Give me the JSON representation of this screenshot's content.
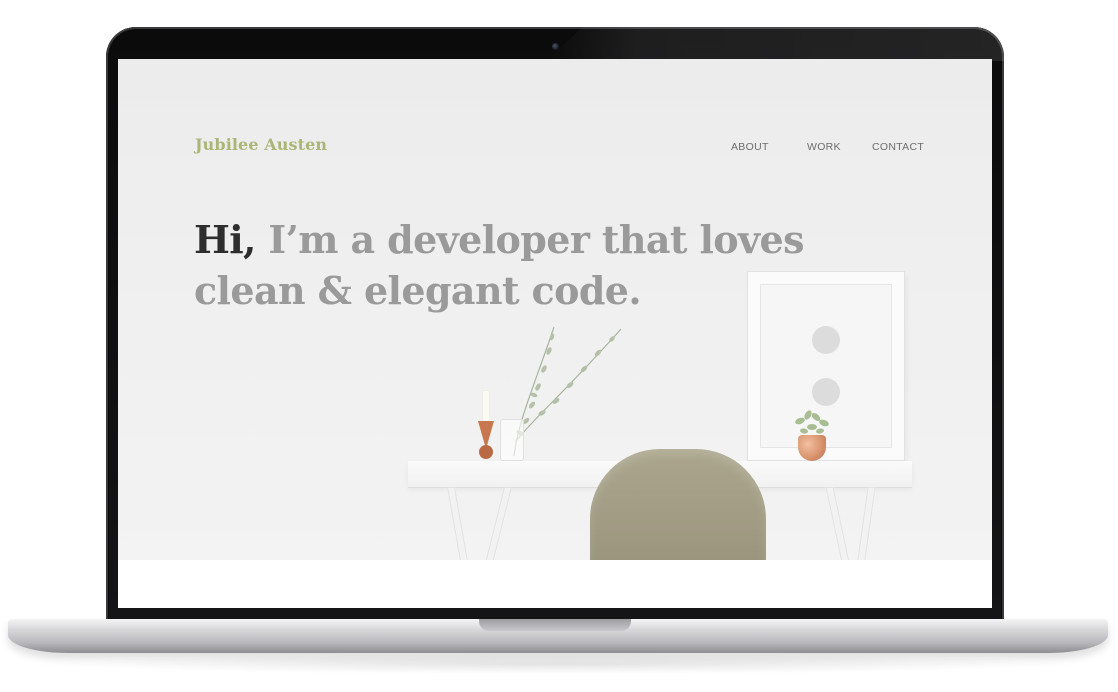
{
  "brand": {
    "name": "Jubilee Austen",
    "color": "#a9b676"
  },
  "nav": {
    "items": [
      {
        "label": "ABOUT"
      },
      {
        "label": "WORK"
      },
      {
        "label": "CONTACT"
      }
    ]
  },
  "hero": {
    "greeting": "Hi,",
    "line1": " I’m a developer that loves",
    "line2": "clean & elegant code."
  },
  "colors": {
    "greeting_text": "#2e2e2e",
    "headline_text": "#9a9a9a",
    "nav_text": "#6d6d6d",
    "chair": "#a39e85"
  },
  "icons": {
    "camera": "camera-icon"
  }
}
